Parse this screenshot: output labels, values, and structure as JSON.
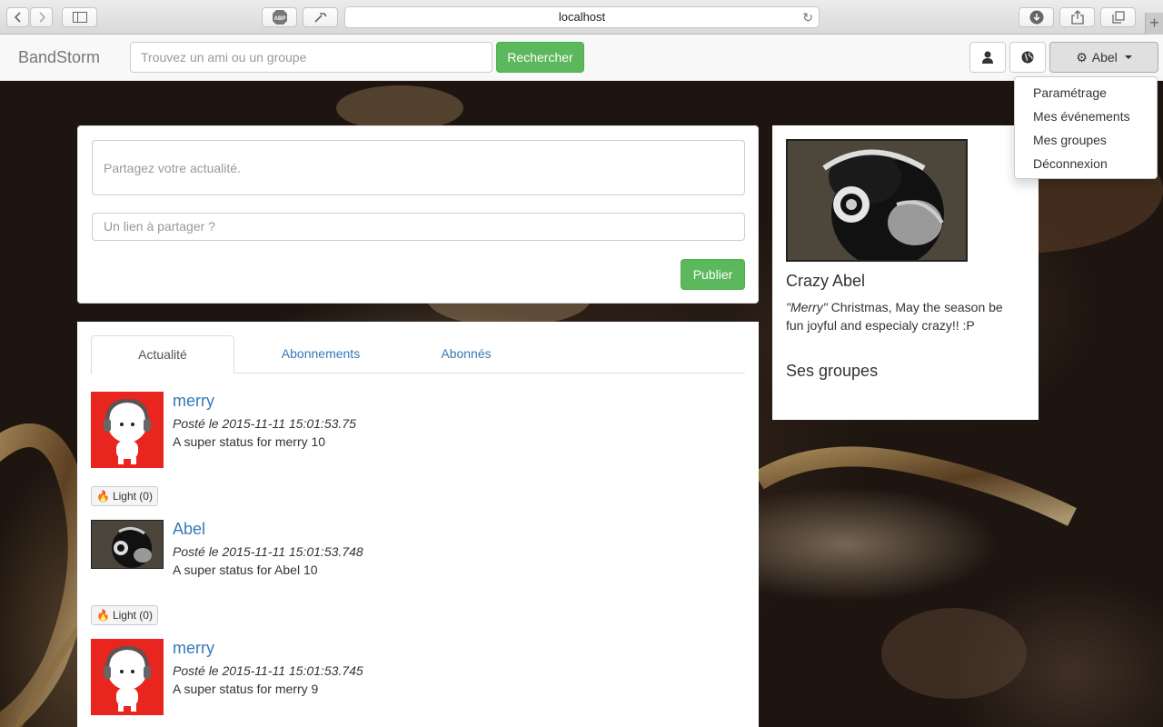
{
  "browser": {
    "url": "localhost"
  },
  "navbar": {
    "brand": "BandStorm",
    "search_placeholder": "Trouvez un ami ou un groupe",
    "search_button": "Rechercher",
    "user_menu_label": "Abel"
  },
  "user_dropdown": {
    "items": [
      "Paramétrage",
      "Mes événements",
      "Mes groupes",
      "Déconnexion"
    ]
  },
  "post_form": {
    "status_placeholder": "Partagez votre actualité.",
    "link_placeholder": "Un lien à partager ?",
    "publish_button": "Publier"
  },
  "tabs": [
    {
      "label": "Actualité",
      "active": true
    },
    {
      "label": "Abonnements",
      "active": false
    },
    {
      "label": "Abonnés",
      "active": false
    }
  ],
  "posts": [
    {
      "author": "merry",
      "date": "Posté le 2015-11-11 15:01:53.75",
      "text": "A super status for merry 10",
      "light": "Light (0)",
      "avatar": "merry-avatar"
    },
    {
      "author": "Abel",
      "date": "Posté le 2015-11-11 15:01:53.748",
      "text": "A super status for Abel 10",
      "light": "Light (0)",
      "avatar": "chimp-avatar"
    },
    {
      "author": "merry",
      "date": "Posté le 2015-11-11 15:01:53.745",
      "text": "A super status for merry 9",
      "light": "",
      "avatar": "merry-avatar"
    }
  ],
  "profile": {
    "name": "Crazy Abel",
    "quote_emph": "\"Merry\"",
    "quote_rest": " Christmas, May the season be fun joyful and especialy crazy!! :P",
    "groups_title": "Ses groupes"
  },
  "colors": {
    "brand_green": "#5cb85c",
    "link_blue": "#337ab7",
    "merry_red": "#e8251f"
  }
}
